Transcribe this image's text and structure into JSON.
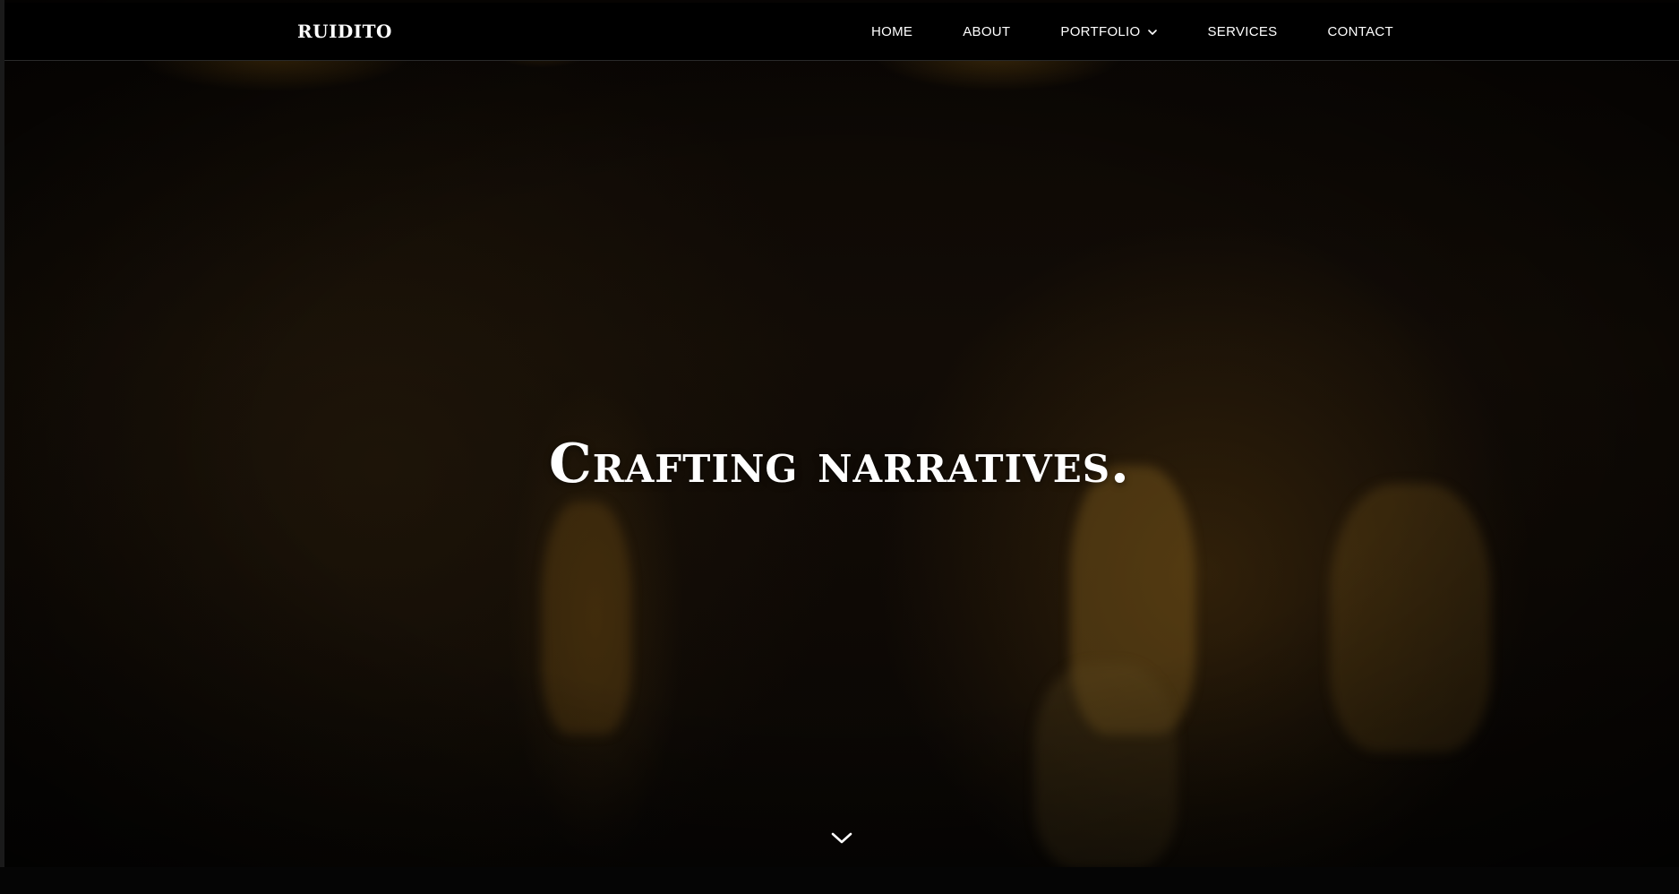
{
  "brand": {
    "name": "RUIDITO"
  },
  "nav": {
    "items": [
      {
        "label": "HOME"
      },
      {
        "label": "ABOUT"
      },
      {
        "label": "PORTFOLIO",
        "has_dropdown": true
      },
      {
        "label": "SERVICES"
      },
      {
        "label": "CONTACT"
      }
    ]
  },
  "hero": {
    "headline": "Crafting narratives.",
    "scroll_icon": "chevron-down-icon"
  },
  "colors": {
    "navbar_bg": "#000000",
    "text": "#ffffff",
    "hero_tint": "#1a1208"
  }
}
